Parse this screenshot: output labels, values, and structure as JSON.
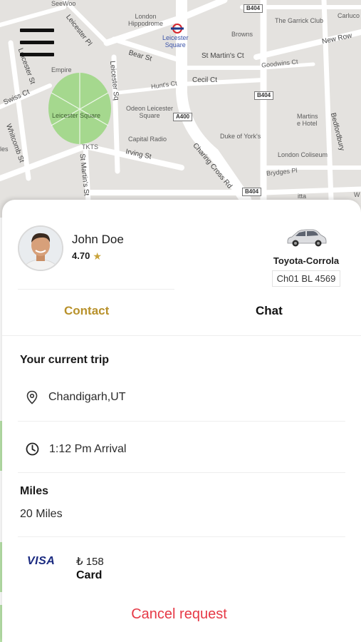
{
  "map": {
    "labels": {
      "seewoo": "SeeWoo",
      "london_hippodrome": "London\nHippodrome",
      "leicester_square_station": "Leicester\nSquare",
      "garrick_club": "The Garrick Club",
      "carluccio": "Carluco",
      "browns": "Browns",
      "new_row": "New Row",
      "leicester_pl": "Leicester Pl",
      "bear_st": "Bear St",
      "st_martins_ct": "St Martin's Ct",
      "goodwins_ct": "Goodwins Ct",
      "empire": "Empire",
      "leicester_st": "Leicester St",
      "leicester_sq_st": "Leicester Sq",
      "hunts_ct": "Hunt's Ct",
      "cecil_ct": "Cecil Ct",
      "swiss_ct": "Swiss Ct",
      "leicester_square_park": "Leicester Square",
      "odeon": "Odeon Leicester\nSquare",
      "martins_lane_hotel": "Martins\ne Hotel",
      "bedfordbury": "Bedfordbury",
      "whitcomb_st": "Whitcomb St",
      "capital_radio": "Capital Radio",
      "duke_of_yorks": "Duke of York's",
      "tkts": "TKTS",
      "irving_st": "Irving St",
      "charing_cross_rd": "Charing Cross Rd",
      "london_coliseum": "London Coliseum",
      "st_martins_st": "St Martin's St",
      "brydges_pl": "Brydges Pl",
      "les": "les",
      "itta": "itta",
      "w": "W"
    },
    "road_badges": {
      "b404_top": "B404",
      "b404_mid": "B404",
      "a400": "A400",
      "b404_bottom": "B404"
    }
  },
  "driver": {
    "name": "John Doe",
    "rating": "4.70",
    "car_model": "Toyota-Corrola",
    "plate": "Ch01 BL 4569"
  },
  "tabs": {
    "contact": "Contact",
    "chat": "Chat"
  },
  "trip": {
    "title": "Your current trip",
    "location": "Chandigarh,UT",
    "arrival": "1:12 Pm Arrival"
  },
  "distance": {
    "title": "Miles",
    "value": "20 Miles"
  },
  "payment": {
    "brand": "VISA",
    "amount": "₺ 158",
    "method": "Card"
  },
  "actions": {
    "cancel": "Cancel request"
  },
  "colors": {
    "accent": "#b8912b",
    "cancel": "#e63946",
    "star": "#c9a33a",
    "park": "#a5d88e"
  }
}
